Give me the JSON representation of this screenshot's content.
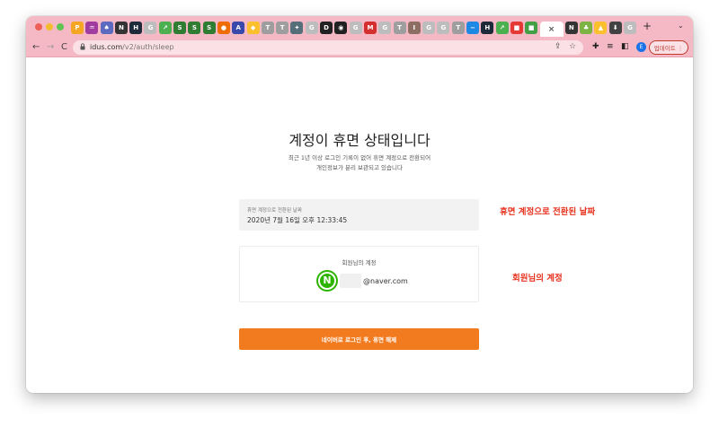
{
  "browser": {
    "tabs": [
      {
        "name": "tab-favicon-1",
        "icon": "P",
        "color": "#f5a623"
      },
      {
        "name": "tab-favicon-2",
        "icon": "♒",
        "color": "#a03ca0"
      },
      {
        "name": "tab-favicon-3",
        "icon": "♠",
        "color": "#5c6bc0"
      },
      {
        "name": "tab-favicon-4",
        "icon": "N",
        "color": "#333333"
      },
      {
        "name": "tab-favicon-5",
        "icon": "H",
        "color": "#1d2a3a"
      },
      {
        "name": "tab-favicon-6",
        "icon": "G",
        "color": "#bdbdbd"
      },
      {
        "name": "tab-favicon-7",
        "icon": "↗",
        "color": "#4caf50"
      },
      {
        "name": "tab-favicon-8",
        "icon": "S",
        "color": "#2e7d32"
      },
      {
        "name": "tab-favicon-9",
        "icon": "S",
        "color": "#2e7d32"
      },
      {
        "name": "tab-favicon-10",
        "icon": "S",
        "color": "#2e7d32"
      },
      {
        "name": "tab-favicon-11",
        "icon": "●",
        "color": "#ef6c00"
      },
      {
        "name": "tab-favicon-12",
        "icon": "A",
        "color": "#3949ab"
      },
      {
        "name": "tab-favicon-13",
        "icon": "◆",
        "color": "#fbc02d"
      },
      {
        "name": "tab-favicon-14",
        "icon": "T",
        "color": "#9e9e9e"
      },
      {
        "name": "tab-favicon-15",
        "icon": "T",
        "color": "#9e9e9e"
      },
      {
        "name": "tab-favicon-16",
        "icon": "✦",
        "color": "#546e7a"
      },
      {
        "name": "tab-favicon-17",
        "icon": "G",
        "color": "#bdbdbd"
      },
      {
        "name": "tab-favicon-18",
        "icon": "D",
        "color": "#212121"
      },
      {
        "name": "tab-favicon-19",
        "icon": "◉",
        "color": "#212121"
      },
      {
        "name": "tab-favicon-20",
        "icon": "G",
        "color": "#bdbdbd"
      },
      {
        "name": "tab-favicon-21",
        "icon": "M",
        "color": "#d32f2f"
      },
      {
        "name": "tab-favicon-22",
        "icon": "G",
        "color": "#bdbdbd"
      },
      {
        "name": "tab-favicon-23",
        "icon": "T",
        "color": "#9e9e9e"
      },
      {
        "name": "tab-favicon-24",
        "icon": "I",
        "color": "#8d6e63"
      },
      {
        "name": "tab-favicon-25",
        "icon": "G",
        "color": "#bdbdbd"
      },
      {
        "name": "tab-favicon-26",
        "icon": "G",
        "color": "#bdbdbd"
      },
      {
        "name": "tab-favicon-27",
        "icon": "T",
        "color": "#9e9e9e"
      },
      {
        "name": "tab-favicon-28",
        "icon": "−",
        "color": "#1e88e5"
      },
      {
        "name": "tab-favicon-29",
        "icon": "H",
        "color": "#1d2a3a"
      },
      {
        "name": "tab-favicon-30",
        "icon": "↗",
        "color": "#4caf50"
      },
      {
        "name": "tab-favicon-31",
        "icon": "■",
        "color": "#e53935"
      },
      {
        "name": "tab-favicon-32",
        "icon": "■",
        "color": "#43a047"
      }
    ],
    "active_tab_close": "×",
    "tabs_after": [
      {
        "name": "tab-favicon-33",
        "icon": "N",
        "color": "#333333"
      },
      {
        "name": "tab-favicon-34",
        "icon": "♣",
        "color": "#7cb342"
      },
      {
        "name": "tab-favicon-35",
        "icon": "▲",
        "color": "#fbc02d"
      },
      {
        "name": "tab-favicon-36",
        "icon": "⬇",
        "color": "#424242"
      },
      {
        "name": "tab-favicon-37",
        "icon": "G",
        "color": "#bdbdbd"
      }
    ],
    "new_tab": "+",
    "tab_menu": "⌄",
    "back": "←",
    "forward": "→",
    "reload": "C",
    "url_host": "idus.com",
    "url_path": "/v2/auth/sleep",
    "profile_initial": "E",
    "update_label": "업데이트  ⋮"
  },
  "page": {
    "title": "계정이 휴면 상태입니다",
    "description_line1": "최근 1년 이상 로그인 기록이 없어 휴면 계정으로 전환되어",
    "description_line2": "개인정보가 분리 보관되고 있습니다",
    "dormant_date_label": "휴면 계정으로 전환된 날짜",
    "dormant_date_value": "2020년 7월 16일 오후 12:33:45",
    "account_label": "회원님의 계정",
    "naver_logo_letter": "N",
    "email_domain": "@naver.com",
    "cta_label": "네이버로 로그인 후, 휴면 해제"
  },
  "annotations": {
    "date_note": "휴면 계정으로 전환된 날짜",
    "account_note": "회원님의 계정",
    "color": "#e8331f"
  },
  "colors": {
    "tab_bar": "#f4b9c4",
    "cta": "#f27b1f",
    "naver_green": "#2db400"
  }
}
